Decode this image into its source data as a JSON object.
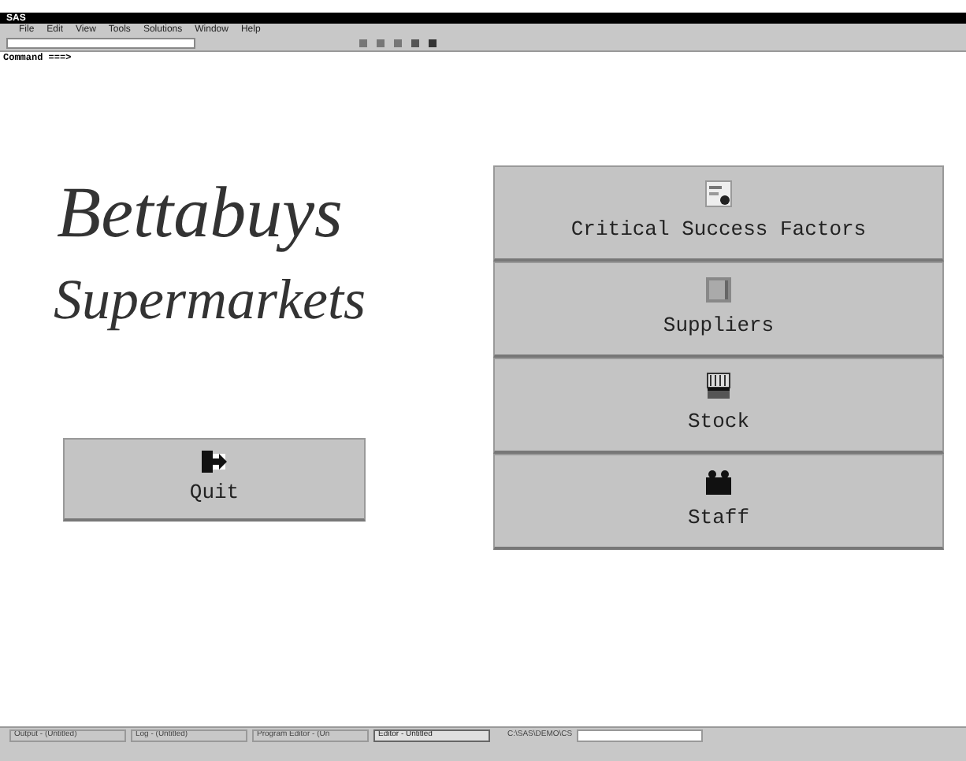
{
  "window": {
    "title": "SAS"
  },
  "menu": [
    "File",
    "Edit",
    "View",
    "Tools",
    "Solutions",
    "Window",
    "Help"
  ],
  "command_label": "Command ===>",
  "logo": {
    "line_1": "Bettabuys",
    "line_2": "Supermarkets"
  },
  "quit_button": {
    "label": "Quit"
  },
  "nav_buttons": [
    {
      "label": "Critical Success Factors",
      "kind": "chart"
    },
    {
      "label": "Suppliers",
      "kind": "book"
    },
    {
      "label": "Stock",
      "kind": "shelf"
    },
    {
      "label": "Staff",
      "kind": "people"
    }
  ],
  "status_tabs": [
    {
      "label": "Output - (Untitled)",
      "selected": false
    },
    {
      "label": "Log - (Untitled)",
      "selected": false
    },
    {
      "label": "Program Editor - (Un",
      "selected": false
    },
    {
      "label": "Editor - Untitled",
      "selected": true
    }
  ],
  "status_path": "C:\\SAS\\DEMO\\CS"
}
